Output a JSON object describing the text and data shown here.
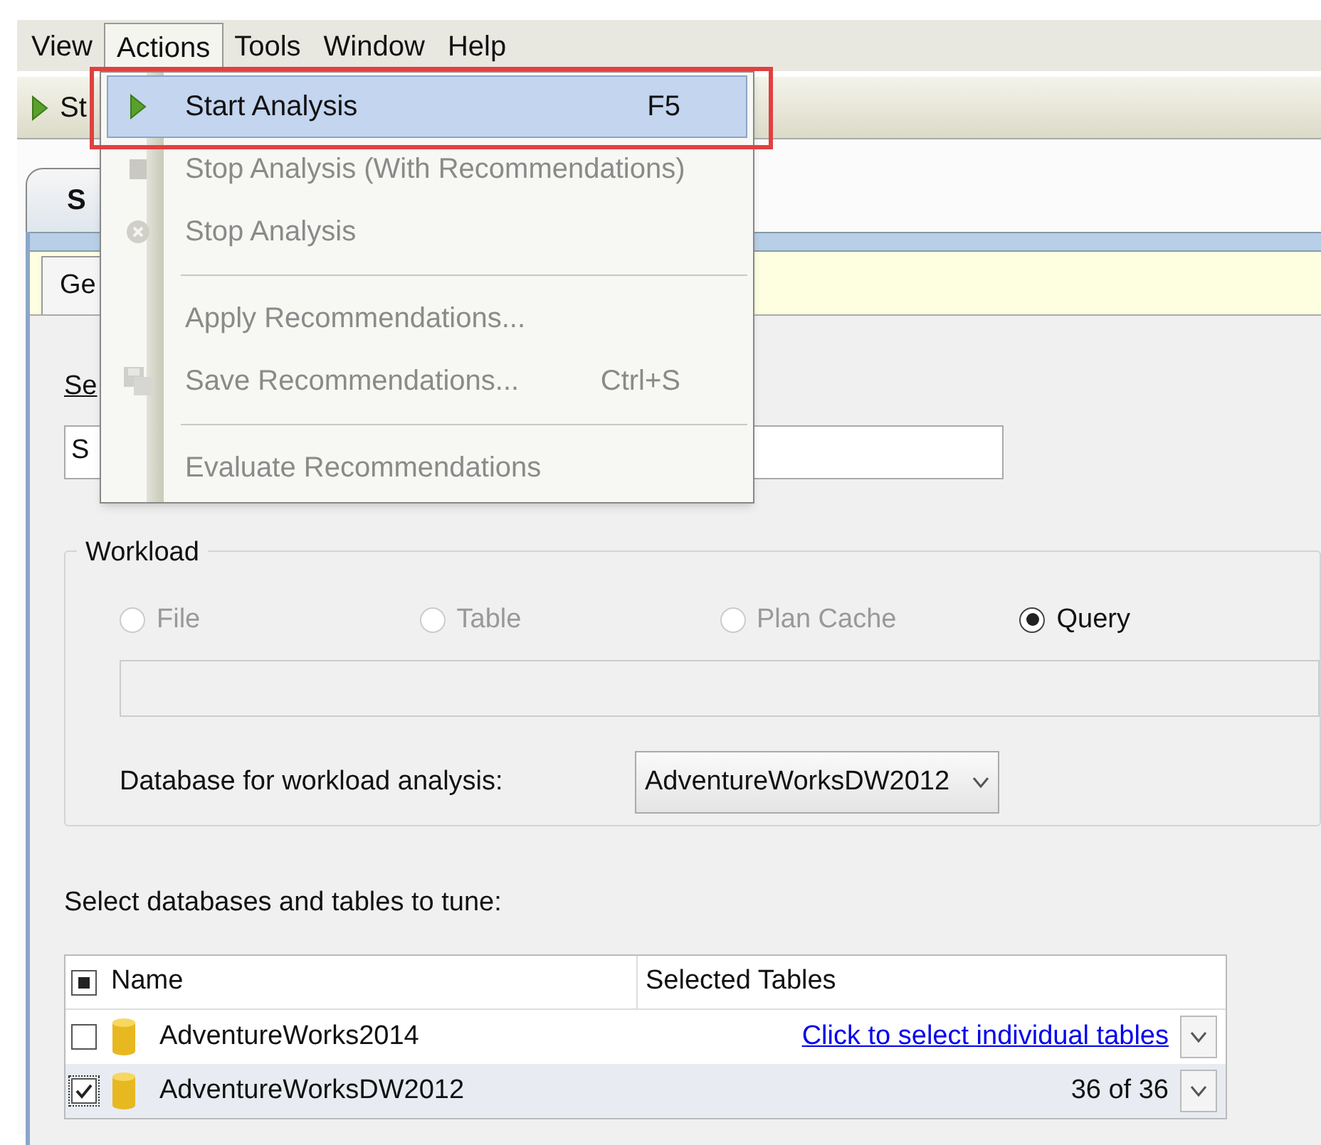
{
  "menubar": [
    {
      "label": "View",
      "selected": false
    },
    {
      "label": "Actions",
      "selected": true
    },
    {
      "label": "Tools",
      "selected": false
    },
    {
      "label": "Window",
      "selected": false
    },
    {
      "label": "Help",
      "selected": false
    }
  ],
  "toolbar": {
    "button_label": "St"
  },
  "document_tab": {
    "label": "S"
  },
  "inner_tab": {
    "label": "Ge"
  },
  "session": {
    "label": "Se",
    "value": "S"
  },
  "menu": {
    "items": [
      {
        "kind": "item",
        "label": "Start Analysis",
        "shortcut": "F5",
        "disabled": false,
        "selected": true,
        "framed": true
      },
      {
        "kind": "item",
        "label": "Stop Analysis (With Recommendations)",
        "disabled": true,
        "selected": false,
        "framed": false
      },
      {
        "kind": "item",
        "label": "Stop Analysis",
        "disabled": true,
        "selected": false,
        "framed": false
      },
      {
        "kind": "separator"
      },
      {
        "kind": "item",
        "label": "Apply Recommendations...",
        "disabled": true,
        "selected": false,
        "framed": false
      },
      {
        "kind": "item",
        "label": "Save Recommendations...",
        "shortcut": "Ctrl+S",
        "disabled": true,
        "selected": false,
        "framed": false
      },
      {
        "kind": "separator"
      },
      {
        "kind": "item",
        "label": "Evaluate Recommendations",
        "disabled": true,
        "selected": false,
        "framed": false
      }
    ]
  },
  "workload": {
    "title": "Workload",
    "options": [
      {
        "label": "File",
        "selected": false,
        "disabled": true
      },
      {
        "label": "Table",
        "selected": false,
        "disabled": true
      },
      {
        "label": "Plan Cache",
        "selected": false,
        "disabled": true
      },
      {
        "label": "Query",
        "selected": true,
        "disabled": false
      }
    ],
    "database_label": "Database for workload analysis:",
    "database_value": "AdventureWorksDW2012"
  },
  "databases": {
    "label": "Select databases and tables to tune:",
    "header_indeterminate": true,
    "columns": [
      "Name",
      "Selected Tables"
    ],
    "rows": [
      {
        "name": "AdventureWorks2014",
        "checked": false,
        "selected": false,
        "tables": "Click to select individual tables",
        "link": true
      },
      {
        "name": "AdventureWorksDW2012",
        "checked": true,
        "selected": true,
        "tables": "36 of 36",
        "link": false
      }
    ]
  }
}
